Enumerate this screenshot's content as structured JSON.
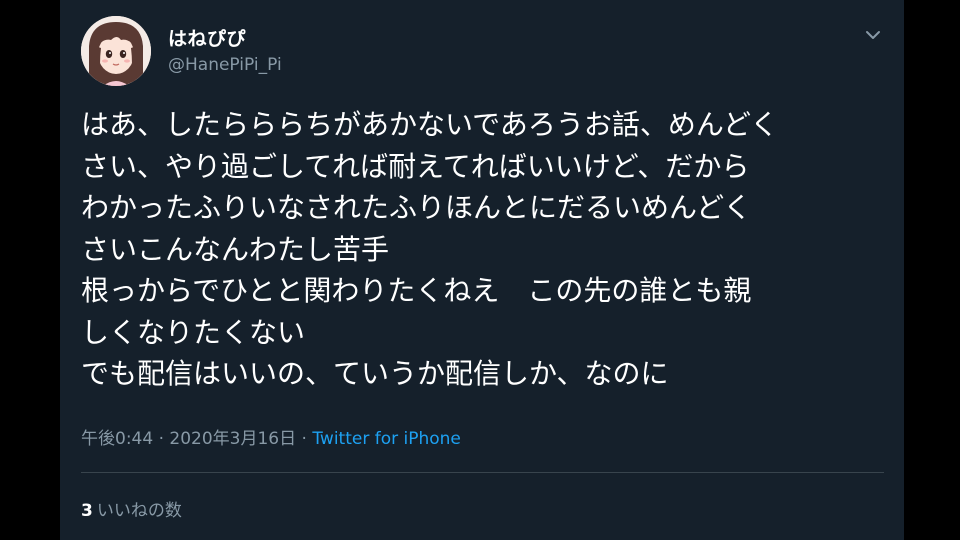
{
  "user": {
    "display_name": "はねぴぴ",
    "handle": "@HanePiPi_Pi"
  },
  "tweet": {
    "lines": [
      "はあ、したらららちがあかないであろうお話、めんどく",
      "さい、やり過ごしてれば耐えてればいいけど、だから",
      "わかったふりいなされたふりほんとにだるいめんどく",
      "さいこんなんわたし苦手",
      "根っからでひとと関わりたくねえ　この先の誰とも親",
      "しくなりたくない",
      "でも配信はいいの、ていうか配信しか、なのに"
    ],
    "time": "午後0:44",
    "separator": "·",
    "date": "2020年3月16日",
    "source": "Twitter for iPhone"
  },
  "stats": {
    "like_count": "3",
    "like_label": "いいねの数"
  },
  "icons": {
    "menu": "chevron-down-icon",
    "avatar": "avatar"
  },
  "colors": {
    "background": "#15202b",
    "outer": "#000000",
    "text": "#ffffff",
    "secondary": "#8899a6",
    "link": "#1da1f2",
    "divider": "#38444d"
  }
}
